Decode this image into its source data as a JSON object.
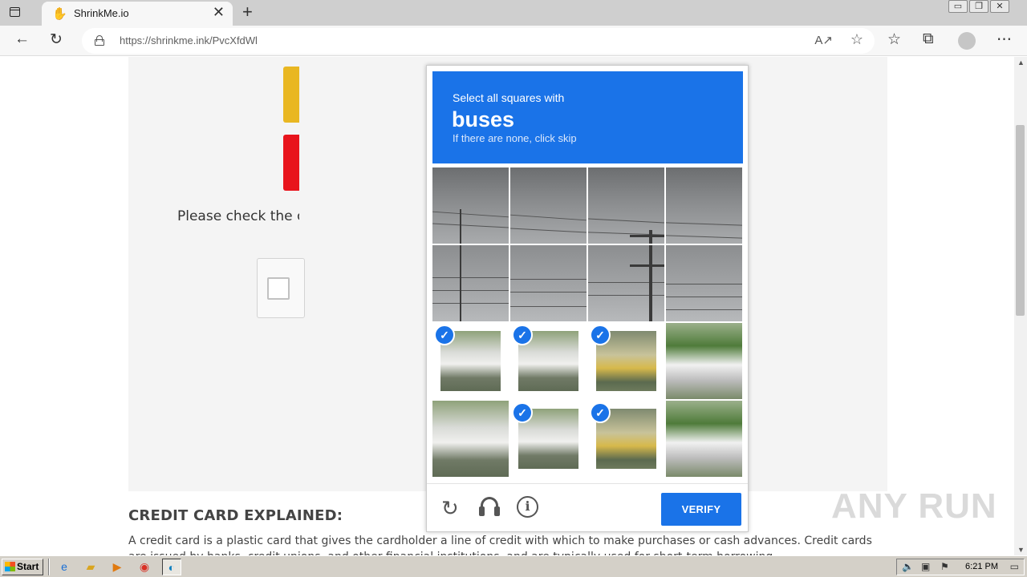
{
  "browser": {
    "tab_title": "ShrinkMe.io",
    "url": "https://shrinkme.ink/PvcXfdWl",
    "tab_close": "✕",
    "new_tab": "+",
    "window_controls": [
      "▭",
      "❐",
      "✕"
    ]
  },
  "page": {
    "check_text": "Please check the ca",
    "section_heading": "CREDIT CARD EXPLAINED:",
    "section_body": "A credit card is a plastic card that gives the cardholder a line of credit with which to make purchases or cash advances. Credit cards are issued by banks, credit unions, and other financial institutions, and are typically used for short-term borrowing."
  },
  "captcha": {
    "prompt_line": "Select all squares with",
    "target": "buses",
    "hint": "If there are none, click skip",
    "verify_label": "VERIFY",
    "check_mark": "✓",
    "selected_tiles": [
      8,
      9,
      10,
      13,
      14
    ],
    "tile_count": 16
  },
  "watermark": "ANY RUN",
  "taskbar": {
    "start_label": "Start",
    "clock": "6:21 PM"
  },
  "colors": {
    "accent": "#1a73e8",
    "tab_bar": "#cfcfcf",
    "taskbar": "#d4d0c8"
  },
  "icons": [
    "tab-actions-icon",
    "back-icon",
    "reload-icon",
    "lock-icon",
    "read-aloud-icon",
    "add-favorite-icon",
    "favorites-icon",
    "collections-icon",
    "profile-icon",
    "menu-icon",
    "captcha-reload-icon",
    "headphones-icon",
    "info-icon",
    "checkmark-icon"
  ]
}
